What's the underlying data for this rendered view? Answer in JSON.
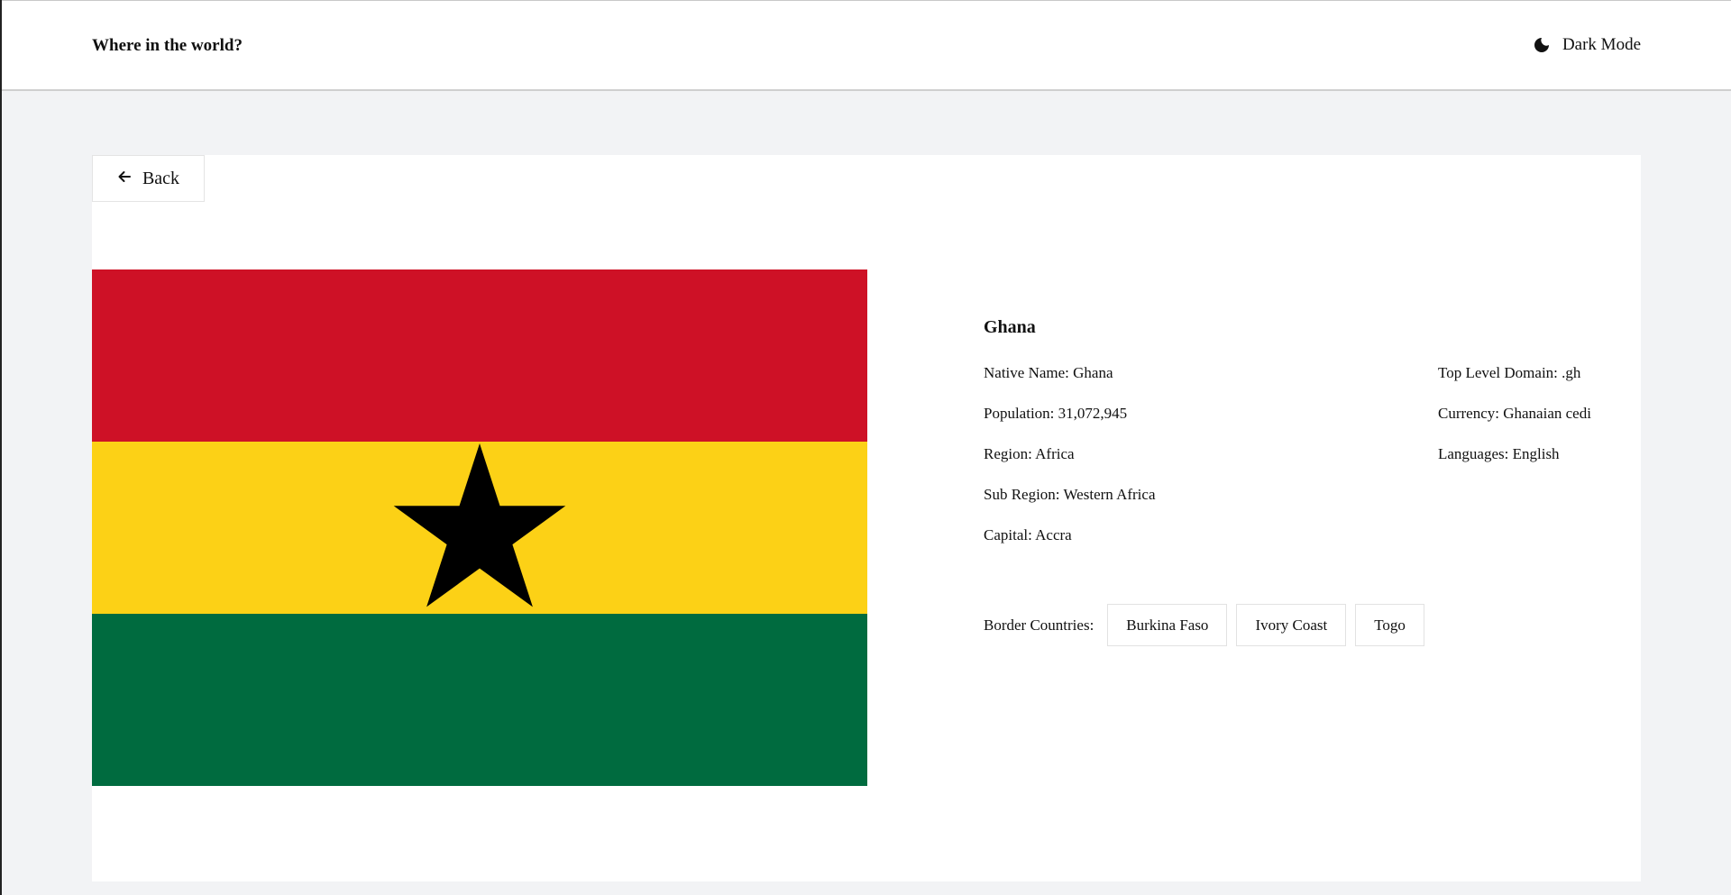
{
  "header": {
    "title": "Where in the world?",
    "mode_label": "Dark Mode",
    "mode_icon": "moon-icon"
  },
  "back": {
    "label": "Back",
    "icon": "arrow-left-icon"
  },
  "country": {
    "name": "Ghana",
    "flag_colors": {
      "red": "#ce1126",
      "yellow": "#fcd116",
      "green": "#006b3f",
      "star": "#000000"
    },
    "left_details": [
      {
        "label": "Native Name:",
        "value": "Ghana"
      },
      {
        "label": "Population:",
        "value": "31,072,945"
      },
      {
        "label": "Region:",
        "value": "Africa"
      },
      {
        "label": "Sub Region:",
        "value": "Western Africa"
      },
      {
        "label": "Capital:",
        "value": "Accra"
      }
    ],
    "right_details": [
      {
        "label": "Top Level Domain:",
        "value": ".gh"
      },
      {
        "label": "Currency:",
        "value": "Ghanaian cedi"
      },
      {
        "label": "Languages:",
        "value": "English"
      }
    ],
    "border_label": "Border Countries:",
    "borders": [
      "Burkina Faso",
      "Ivory Coast",
      "Togo"
    ]
  }
}
